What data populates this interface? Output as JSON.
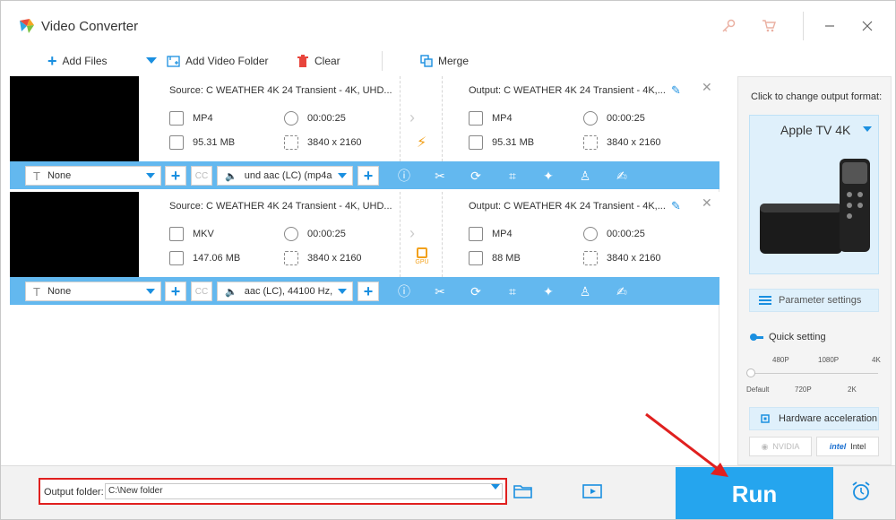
{
  "window": {
    "title": "Video Converter"
  },
  "toolbar": {
    "add_files": "Add Files",
    "add_folder": "Add Video Folder",
    "clear": "Clear",
    "merge": "Merge"
  },
  "items": [
    {
      "source_title": "Source: C  WEATHER  4K 24  Transient - 4K, UHD...",
      "output_title": "Output: C  WEATHER  4K 24  Transient - 4K,...",
      "src_format": "MP4",
      "src_duration": "00:00:25",
      "src_size": "95.31 MB",
      "src_resolution": "3840 x 2160",
      "out_format": "MP4",
      "out_duration": "00:00:25",
      "out_size": "95.31 MB",
      "out_resolution": "3840 x 2160",
      "subtitle": "None",
      "audio": "und aac (LC) (mp4a"
    },
    {
      "source_title": "Source: C  WEATHER  4K 24  Transient - 4K, UHD...",
      "output_title": "Output: C  WEATHER  4K 24  Transient - 4K,...",
      "src_format": "MKV",
      "src_duration": "00:00:25",
      "src_size": "147.06 MB",
      "src_resolution": "3840 x 2160",
      "out_format": "MP4",
      "out_duration": "00:00:25",
      "out_size": "88 MB",
      "out_resolution": "3840 x 2160",
      "subtitle": "None",
      "audio": "aac (LC), 44100 Hz,",
      "gpu_label": "GPU"
    }
  ],
  "right_panel": {
    "click_label": "Click to change output format:",
    "format": "Apple TV 4K",
    "parameter_settings": "Parameter settings",
    "quick_setting": "Quick setting",
    "ticks_top": [
      "480P",
      "1080P",
      "4K"
    ],
    "ticks_bottom": [
      "Default",
      "720P",
      "2K"
    ],
    "quality_level": 0,
    "hardware_acceleration": "Hardware acceleration",
    "nvidia": "NVIDIA",
    "intel": "Intel"
  },
  "bottom": {
    "output_folder_label": "Output folder:",
    "output_folder_value": "C:\\New folder",
    "run": "Run"
  },
  "colors": {
    "accent": "#1a8fe0",
    "editbar": "#63b8ef",
    "run": "#25a5ee",
    "highlight": "#e0201f"
  }
}
